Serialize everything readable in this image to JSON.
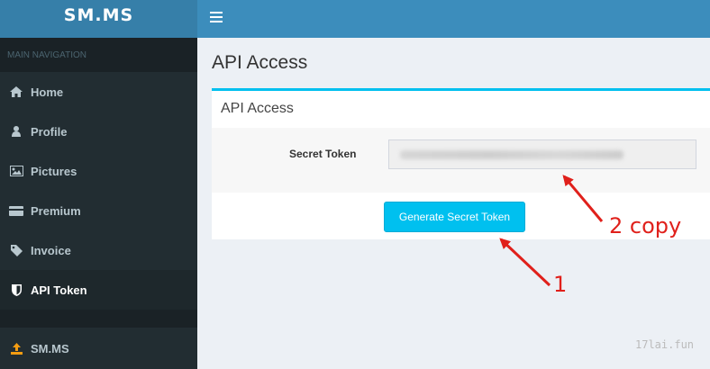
{
  "app": {
    "logo": "SM.MS"
  },
  "sidebar": {
    "header": "MAIN NAVIGATION",
    "items": [
      {
        "label": "Home",
        "icon": "home-icon"
      },
      {
        "label": "Profile",
        "icon": "user-icon"
      },
      {
        "label": "Pictures",
        "icon": "image-icon"
      },
      {
        "label": "Premium",
        "icon": "credit-card-icon"
      },
      {
        "label": "Invoice",
        "icon": "tag-icon"
      },
      {
        "label": "API Token",
        "icon": "shield-icon",
        "active": true
      }
    ],
    "bottom_item": {
      "label": "SM.MS",
      "icon": "upload-icon"
    }
  },
  "main": {
    "page_title": "API Access",
    "box": {
      "title": "API Access",
      "secret_token_label": "Secret Token",
      "generate_button": "Generate Secret Token"
    }
  },
  "annotations": {
    "step1": "1",
    "step2": "2  copy",
    "watermark": "17lai.fun"
  },
  "colors": {
    "topbar": "#3c8dbc",
    "sidebar": "#222d32",
    "accent": "#00c0ef",
    "annotation": "#e0201b"
  }
}
